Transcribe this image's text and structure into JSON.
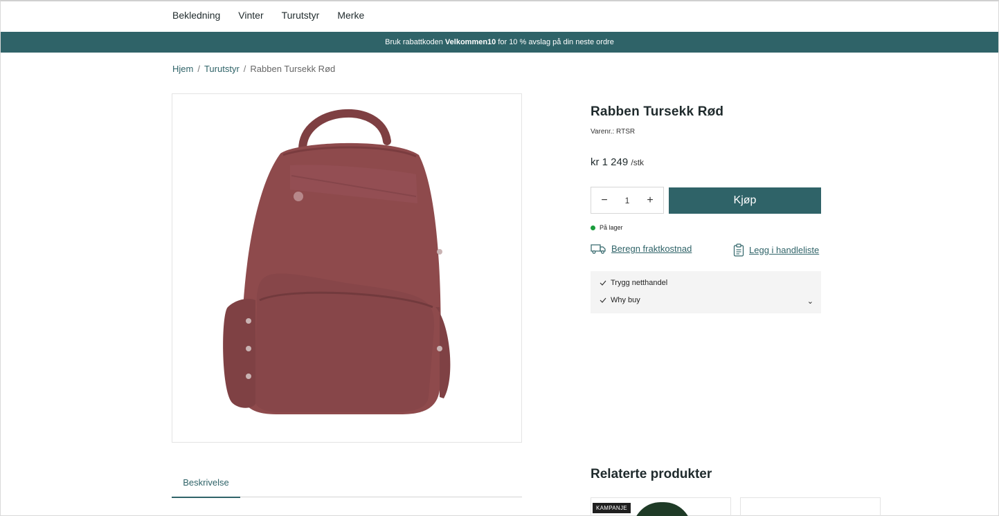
{
  "nav": {
    "items": [
      "Bekledning",
      "Vinter",
      "Turutstyr",
      "Merke"
    ]
  },
  "promo": {
    "before": "Bruk rabattkoden",
    "code": "Velkommen10",
    "after": "for 10 % avslag på din neste ordre"
  },
  "breadcrumb": {
    "home": "Hjem",
    "category": "Turutstyr",
    "current": "Rabben Tursekk Rød",
    "separator": "/"
  },
  "product": {
    "title": "Rabben Tursekk Rød",
    "sku_label": "Varenr.: RTSR",
    "price": "kr 1 249",
    "price_unit": "/stk",
    "quantity": "1",
    "minus": "−",
    "plus": "+",
    "buy_label": "Kjøp",
    "stock": "På lager",
    "freight_link": "Beregn fraktkostnad",
    "wishlist_link": "Legg i handleliste",
    "image_color": "#8e4a4c"
  },
  "usp": {
    "item1": "Trygg netthandel",
    "item2": "Why buy",
    "chevron": "⌄"
  },
  "tabs": {
    "description": "Beskrivelse"
  },
  "related": {
    "title": "Relaterte produkter",
    "badge": "KAMPANJE"
  },
  "colors": {
    "brand": "#2f6368",
    "stock_green": "#1a9c3c"
  }
}
